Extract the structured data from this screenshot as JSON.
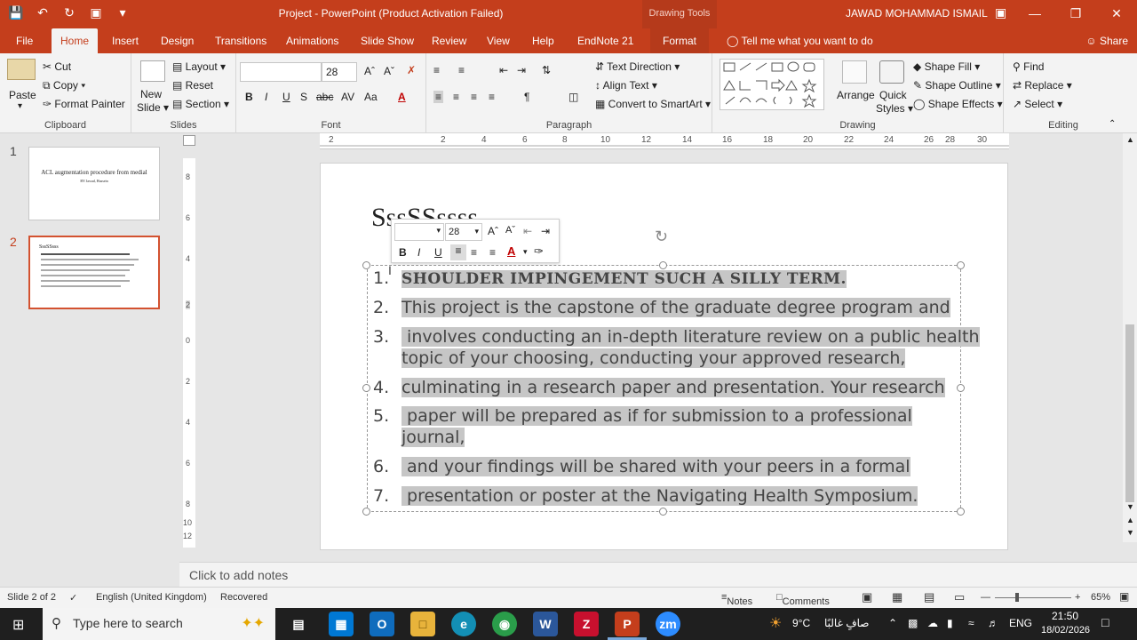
{
  "app": {
    "title": "Project  -  PowerPoint (Product Activation Failed)",
    "context_tab": "Drawing Tools",
    "user": "JAWAD MOHAMMAD ISMAIL"
  },
  "tabs": [
    "File",
    "Home",
    "Insert",
    "Design",
    "Transitions",
    "Animations",
    "Slide Show",
    "Review",
    "View",
    "Help",
    "EndNote 21",
    "Format"
  ],
  "tell_me": "Tell me what you want to do",
  "share": "Share",
  "clipboard": {
    "paste": "Paste",
    "cut": "Cut",
    "copy": "Copy",
    "format_painter": "Format Painter",
    "label": "Clipboard"
  },
  "slides_group": {
    "new_slide": "New",
    "new_slide2": "Slide",
    "layout": "Layout",
    "reset": "Reset",
    "section": "Section",
    "label": "Slides"
  },
  "font": {
    "size": "28",
    "label": "Font"
  },
  "paragraph": {
    "text_direction": "Text Direction",
    "align_text": "Align Text",
    "smartart": "Convert to SmartArt",
    "label": "Paragraph"
  },
  "drawing": {
    "arrange": "Arrange",
    "quick_styles": "Quick",
    "quick_styles2": "Styles",
    "shape_fill": "Shape Fill",
    "shape_outline": "Shape Outline",
    "shape_effects": "Shape Effects",
    "label": "Drawing"
  },
  "editing": {
    "find": "Find",
    "replace": "Replace",
    "select": "Select",
    "label": "Editing"
  },
  "thumbnails": [
    {
      "num": "1",
      "title": "ACL augmentation procedure from medial",
      "sub": "BY Jawad, Hussein"
    },
    {
      "num": "2",
      "title": "SssSSsss"
    }
  ],
  "slide": {
    "title": "SssSSssss",
    "items": [
      {
        "n": "1.",
        "t": "SHOULDER IMPINGEMENT SUCH A SILLY TERM."
      },
      {
        "n": "2.",
        "t": "This project is the capstone of the graduate degree program and"
      },
      {
        "n": "3.",
        "t": " involves conducting an in-depth literature review on a public health"
      },
      {
        "n": "",
        "t": "topic of your choosing, conducting your approved research,"
      },
      {
        "n": "4.",
        "t": "culminating in a research paper and presentation. Your research"
      },
      {
        "n": "5.",
        "t": " paper will be prepared as if for submission to a professional"
      },
      {
        "n": "",
        "t": "journal,"
      },
      {
        "n": "6.",
        "t": " and your findings will be shared with your peers in a formal"
      },
      {
        "n": "7.",
        "t": " presentation or poster at the Navigating Health Symposium."
      }
    ]
  },
  "mini_toolbar": {
    "size": "28"
  },
  "notes_placeholder": "Click to add notes",
  "status": {
    "slide": "Slide 2 of 2",
    "lang": "English (United Kingdom)",
    "recovered": "Recovered",
    "notes": "Notes",
    "comments": "Comments",
    "zoom": "65%"
  },
  "taskbar": {
    "search": "Type here to search",
    "weather": "9°C",
    "weather_text": "صافٍ غالبًا",
    "lang": "ENG",
    "time": "21:50",
    "date": "18/02/2026"
  },
  "ruler_h": [
    "2",
    "2",
    "4",
    "6",
    "8",
    "10",
    "12",
    "14",
    "16",
    "18",
    "20",
    "22",
    "24",
    "26",
    "28",
    "30"
  ],
  "ruler_v": [
    "8",
    "6",
    "4",
    "2",
    "0",
    "2",
    "4",
    "6",
    "8",
    "10",
    "12"
  ]
}
